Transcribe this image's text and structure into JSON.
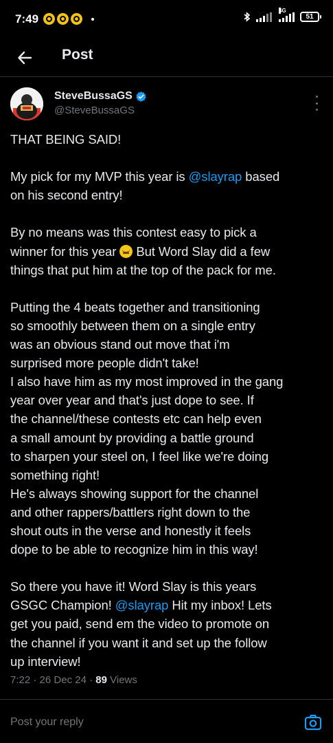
{
  "status_bar": {
    "time": "7:49",
    "network_label": "4G",
    "battery_level": "51",
    "icons": [
      "notification-icon",
      "notification-icon",
      "notification-icon",
      "bluetooth-icon",
      "signal-icon",
      "signal-icon",
      "battery-icon"
    ]
  },
  "header": {
    "title": "Post",
    "back_icon": "arrow-left-icon"
  },
  "author": {
    "display_name": "SteveBussaGS",
    "handle": "@SteveBussaGS",
    "verified": true,
    "verified_color": "#1d9bf0"
  },
  "tweet": {
    "lines": [
      "THAT BEING SAID!",
      "",
      "My pick for my MVP this year is ",
      "@slayrap",
      " based",
      "on his second entry!",
      "",
      "By no means was this contest easy to pick a",
      "winner for this year ",
      " But Word Slay did a few",
      "things that put him at the top of the pack for me.",
      "",
      "Putting the 4 beats together and transitioning",
      "so smoothly between them on a single entry",
      "was an obvious stand out move that i'm",
      "surprised more people didn't take!",
      "I also have him as my most improved in the gang",
      "year over year and that's just dope to see. If",
      "the channel/these contests etc can help even",
      "a small amount by providing a battle ground",
      "to sharpen your steel on, I feel like we're doing",
      "something right!",
      "He's always showing support for the channel",
      "and other rappers/battlers right down to the",
      "shout outs in the verse and honestly it feels",
      "dope to be able to recognize him in this way!",
      "",
      "So there you have it! Word Slay is this years",
      "GSGC Champion! ",
      "@slayrap",
      " Hit my inbox! Lets",
      "get you paid, send em the video to promote on",
      "the channel if you want it and set up the follow",
      "up interview!"
    ],
    "emoji": "upside-down-face-icon",
    "mention_color": "#1d9bf0"
  },
  "meta": {
    "time": "7:22",
    "separator": "·",
    "date": "26 Dec 24",
    "views_count": "89",
    "views_label": "Views"
  },
  "reply": {
    "placeholder": "Post your reply",
    "camera_icon": "camera-icon"
  },
  "colors": {
    "background": "#000000",
    "text": "#e7e9ea",
    "secondary_text": "#71767b",
    "accent": "#1d9bf0",
    "divider": "#2f3336"
  }
}
